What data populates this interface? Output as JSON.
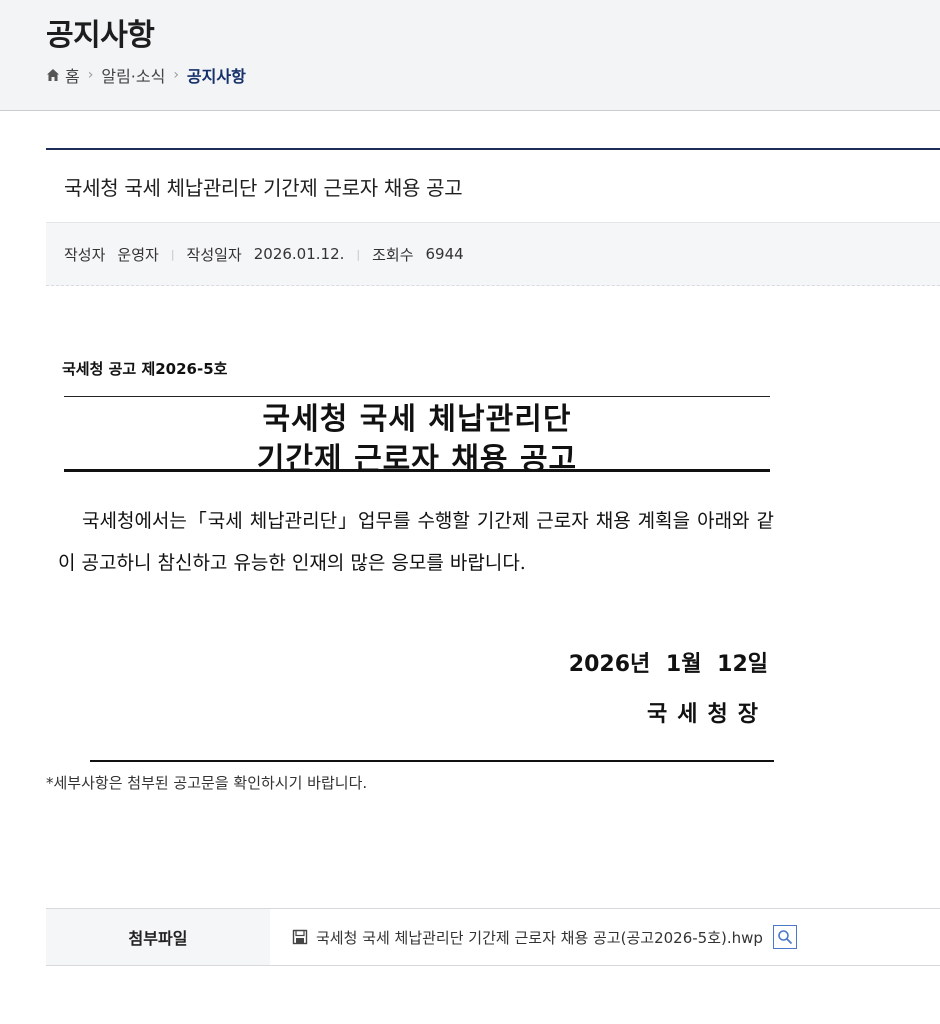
{
  "header": {
    "title": "공지사항",
    "breadcrumb": {
      "home": "홈",
      "sep": "›",
      "section": "알림·소식",
      "current": "공지사항"
    }
  },
  "article": {
    "title": "국세청 국세 체납관리단 기간제 근로자 채용 공고",
    "meta": {
      "author_label": "작성자",
      "author": "운영자",
      "date_label": "작성일자",
      "date": "2026.01.12.",
      "views_label": "조회수",
      "views": "6944",
      "divider": "|"
    }
  },
  "document": {
    "notice_no": "국세청 공고 제2026-5호",
    "heading_line1": "국세청 국세 체납관리단",
    "heading_line2": "기간제 근로자 채용 공고",
    "body": "국세청에서는「국세 체납관리단」업무를 수행할 기간제 근로자 채용 계획을 아래와 같이 공고하니 참신하고 유능한 인재의 많은 응모를 바랍니다.",
    "date": "2026년 1월 12일",
    "signature": "국세청장"
  },
  "footnote": "*세부사항은 첨부된 공고문을 확인하시기 바랍니다.",
  "attachment": {
    "label": "첨부파일",
    "filename": "국세청 국세 체납관리단 기간제 근로자 채용 공고(공고2026-5호).hwp"
  },
  "colors": {
    "accent": "#16306b",
    "preview_border": "#4b79c9"
  }
}
